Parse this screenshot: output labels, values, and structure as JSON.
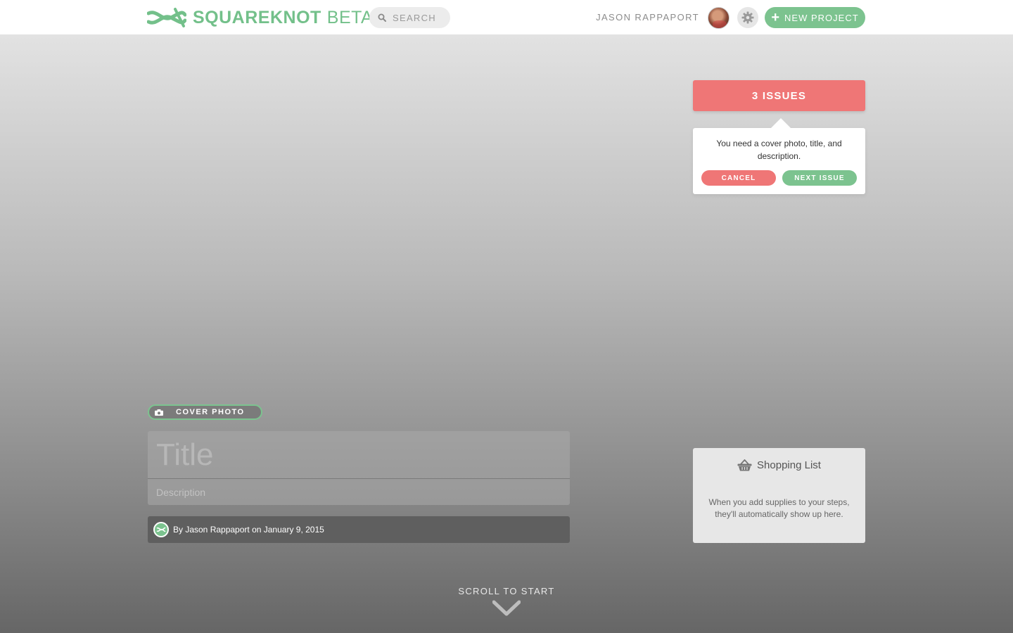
{
  "header": {
    "brand": "SQUAREKNOT",
    "beta": "BETA",
    "search_placeholder": "SEARCH",
    "user_name": "JASON RAPPAPORT",
    "new_project_label": "NEW PROJECT"
  },
  "issues": {
    "button_label": "3 ISSUES",
    "message": "You need a cover photo, title, and description.",
    "cancel_label": "CANCEL",
    "next_label": "NEXT ISSUE"
  },
  "project": {
    "cover_photo_label": "COVER PHOTO",
    "title_placeholder": "Title",
    "description_placeholder": "Description",
    "byline": "By Jason Rappaport on January 9, 2015"
  },
  "shopping_list": {
    "title": "Shopping List",
    "body": "When you add supplies to your steps, they'll automatically show up here."
  },
  "scroll_label": "SCROLL TO START",
  "icons": {
    "logo": "knot-logo-icon",
    "search": "search-icon",
    "gear": "gear-icon",
    "plus": "plus-icon",
    "camera": "camera-icon",
    "basket": "basket-icon",
    "chevron": "chevron-down-icon"
  },
  "colors": {
    "brand_green": "#7cc38f",
    "issue_red": "#ef7676"
  }
}
